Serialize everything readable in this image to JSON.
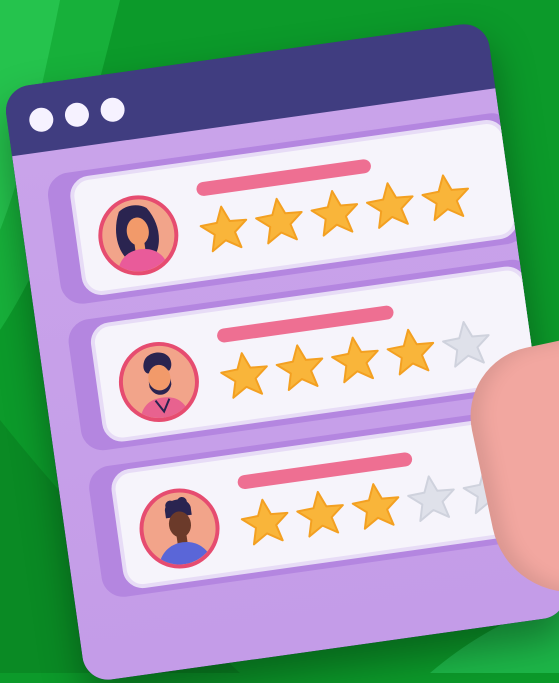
{
  "window": {
    "dots": 3
  },
  "reviews": [
    {
      "rating": 5,
      "max": 5,
      "avatar": "woman-avatar"
    },
    {
      "rating": 4,
      "max": 5,
      "avatar": "bearded-man-avatar"
    },
    {
      "rating": 3,
      "max": 5,
      "avatar": "man-avatar"
    }
  ],
  "colors": {
    "background": "#0c9a2a",
    "star_filled": "#f9b53a",
    "star_empty": "#dfe1ea",
    "bar": "#ee6f92",
    "window_frame": "#403d80",
    "window_body": "#c9a3ea"
  }
}
